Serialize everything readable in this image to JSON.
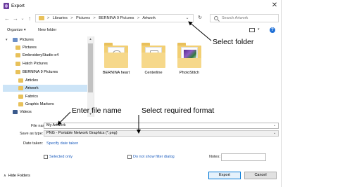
{
  "window": {
    "title": "Export",
    "close_glyph": "✕"
  },
  "address": {
    "back_glyph": "←",
    "forward_glyph": "→",
    "dropdown_glyph": "⌄",
    "up_glyph": "↑",
    "breadcrumbs": [
      "Libraries",
      "Pictures",
      "BERNINA 9 Pictures",
      "Artwork"
    ],
    "separator": ">",
    "refresh_glyph": "↻",
    "search_placeholder": "Search Artwork"
  },
  "toolbar": {
    "organize": "Organize ▾",
    "new_folder": "New folder",
    "help": "?"
  },
  "nav": {
    "items": [
      {
        "label": "Pictures",
        "icon": "library-icon",
        "expander": "▾"
      },
      {
        "label": "Pictures",
        "icon": "folder-icon"
      },
      {
        "label": "EmbroideryStudio e4",
        "icon": "folder-icon"
      },
      {
        "label": "Hatch Pictures",
        "icon": "folder-icon"
      },
      {
        "label": "BERNINA 9 Pictures",
        "icon": "folder-icon"
      },
      {
        "label": "Articles",
        "icon": "folder-icon"
      },
      {
        "label": "Artwork",
        "icon": "folder-icon",
        "selected": true
      },
      {
        "label": "Fabrics",
        "icon": "folder-icon"
      },
      {
        "label": "Graphic Markers",
        "icon": "folder-icon"
      },
      {
        "label": "Videos",
        "icon": "video-icon"
      }
    ]
  },
  "files": [
    {
      "label": "BERNINA heart"
    },
    {
      "label": "Centerline"
    },
    {
      "label": "PhotoStitch"
    }
  ],
  "form": {
    "file_name_label": "File name:",
    "file_name_value": "My Artwork",
    "save_type_label": "Save as type:",
    "save_type_value": "PNG - Portable Network Graphics (*.png)",
    "date_taken_label": "Date taken:",
    "date_taken_link": "Specify date taken",
    "selected_only": "Selected only",
    "no_filter": "Do not show filter dialog",
    "notes_label": "Notes:",
    "notes_value": ""
  },
  "buttons": {
    "export": "Export",
    "cancel": "Cancel"
  },
  "footer": {
    "hide_folders": "Hide Folders",
    "chevron": "∧"
  },
  "annotations": {
    "select_folder": "Select folder",
    "enter_file_name": "Enter file name",
    "select_format": "Select required format"
  },
  "colors": {
    "accent": "#0078d7",
    "link": "#1f5fbf",
    "selection": "#cce4f7"
  }
}
